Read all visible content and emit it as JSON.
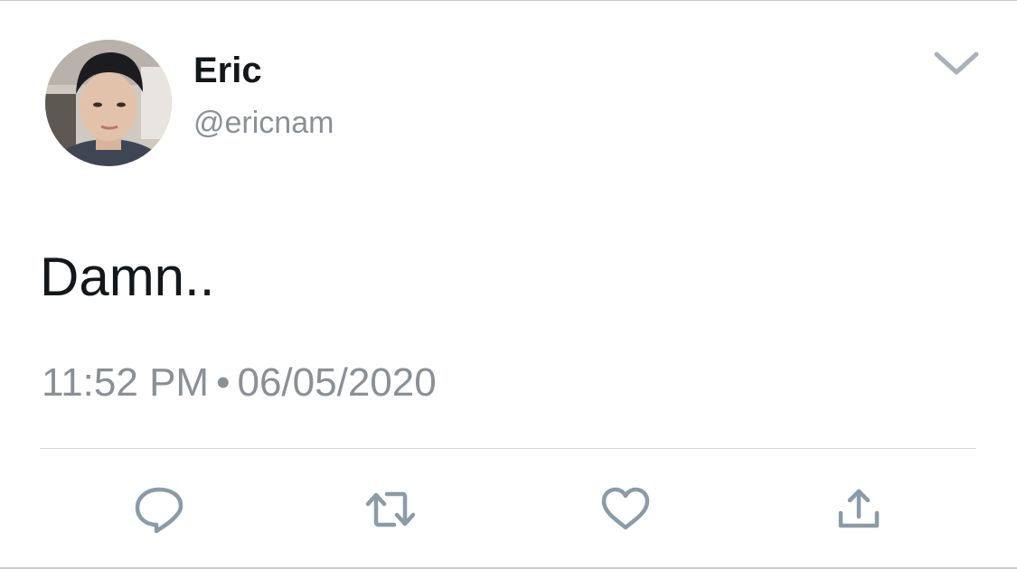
{
  "tweet": {
    "author": {
      "display_name": "Eric",
      "handle": "@ericnam"
    },
    "text": "Damn..",
    "time": "11:52 PM",
    "separator": "•",
    "date": "06/05/2020"
  },
  "actions": [
    {
      "icon": "reply-icon"
    },
    {
      "icon": "retweet-icon"
    },
    {
      "icon": "like-icon"
    },
    {
      "icon": "share-icon"
    }
  ],
  "colors": {
    "text": "#14171a",
    "secondary_text": "#8a9096",
    "icon": "#8a9ba8",
    "divider": "#d2d6da"
  }
}
